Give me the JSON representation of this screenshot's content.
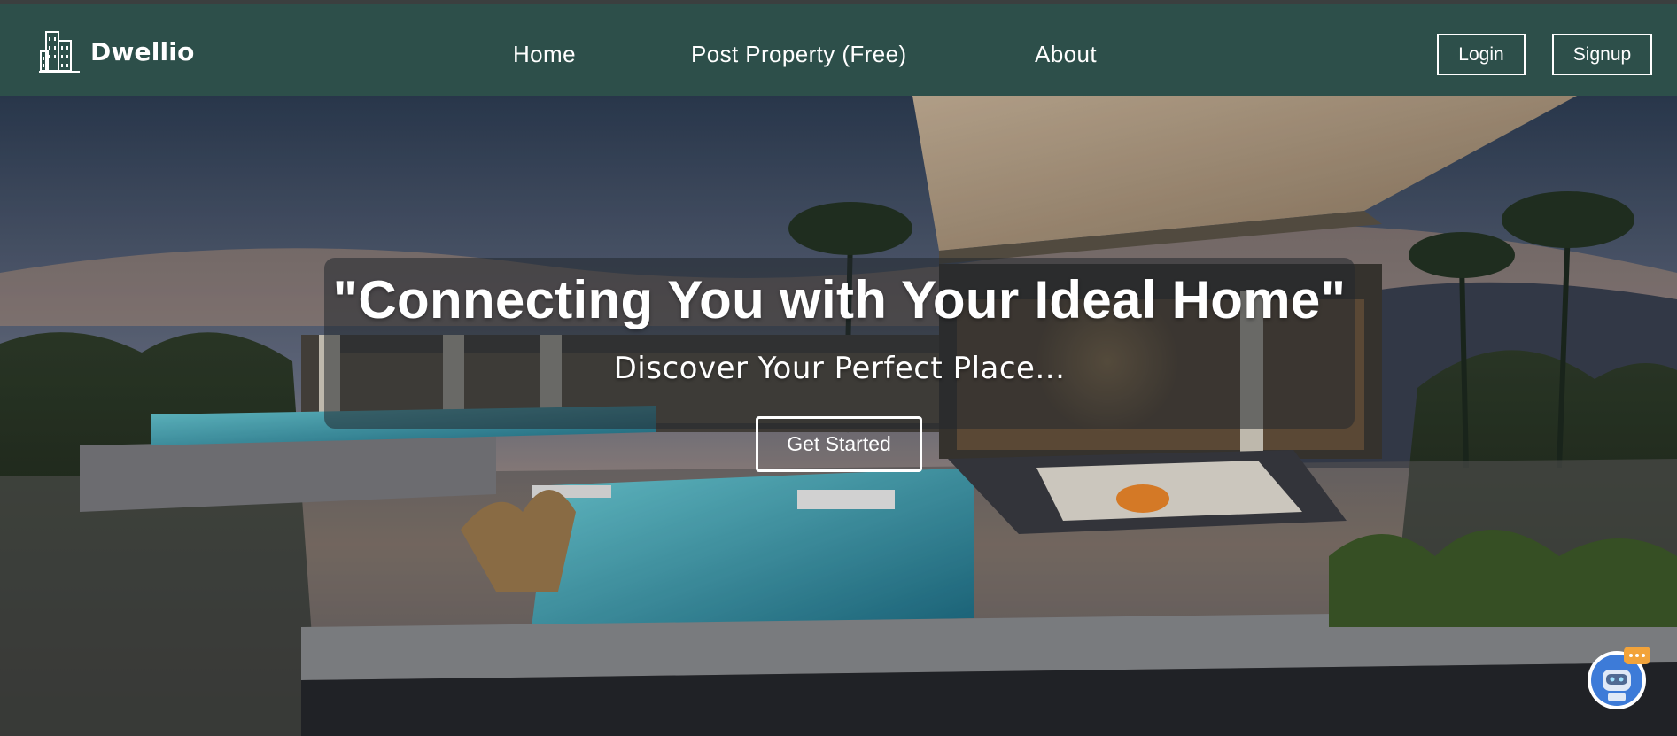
{
  "brand": {
    "name": "Dwellio",
    "icon": "building-icon"
  },
  "nav": {
    "links": [
      {
        "label": "Home"
      },
      {
        "label": "Post Property (Free)"
      },
      {
        "label": "About"
      }
    ],
    "login_label": "Login",
    "signup_label": "Signup"
  },
  "hero": {
    "headline": "\"Connecting You with Your Ideal Home\"",
    "subheadline": "Discover Your Perfect Place...",
    "cta_label": "Get Started",
    "background": "modern-villa-infinity-pool-photo"
  },
  "chat_widget": {
    "icon": "chatbot-icon"
  },
  "colors": {
    "navbar": "#2d4f4a",
    "text": "#ffffff",
    "overlay": "rgba(35,40,45,0.55)"
  }
}
